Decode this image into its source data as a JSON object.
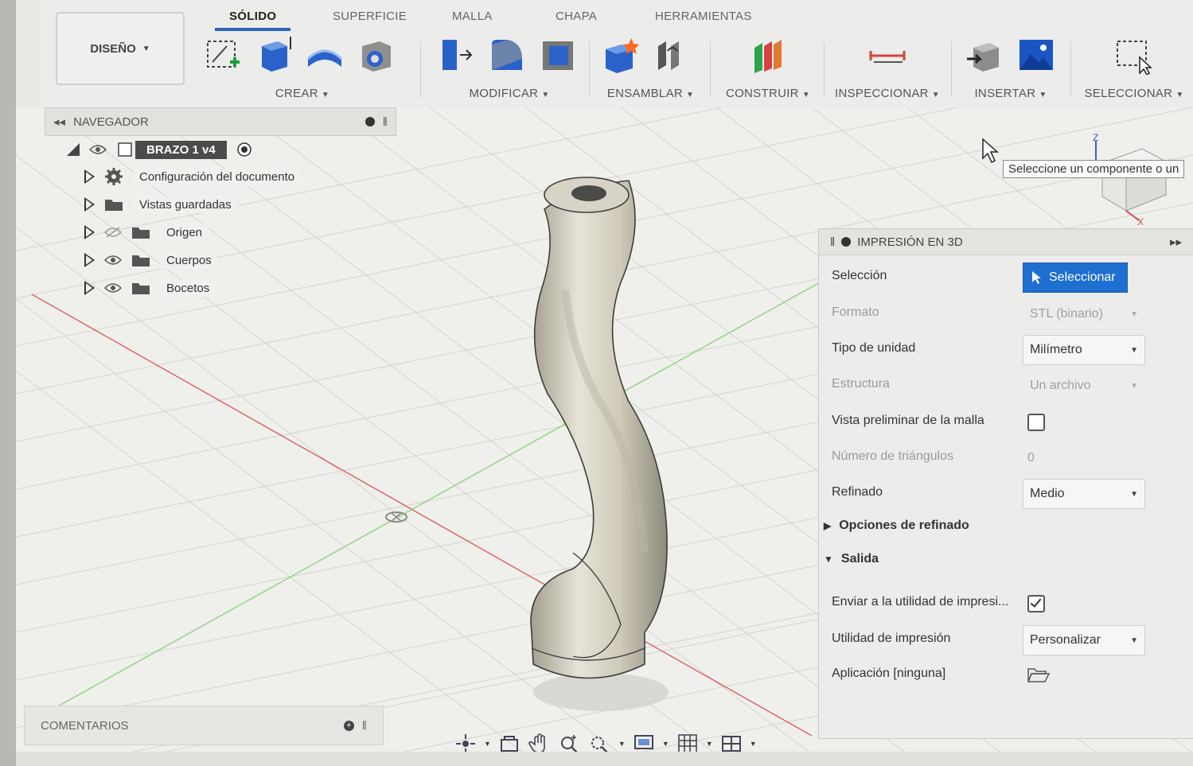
{
  "toolbar": {
    "workspace": "DISEÑO",
    "tabs": [
      "SÓLIDO",
      "SUPERFICIE",
      "MALLA",
      "CHAPA",
      "HERRAMIENTAS"
    ],
    "active_tab": "SÓLIDO",
    "groups": {
      "crear": "CREAR",
      "modificar": "MODIFICAR",
      "ensamblar": "ENSAMBLAR",
      "construir": "CONSTRUIR",
      "inspeccionar": "INSPECCIONAR",
      "insertar": "INSERTAR",
      "seleccionar": "SELECCIONAR"
    }
  },
  "browser": {
    "title": "NAVEGADOR",
    "root": "BRAZO 1 v4",
    "items": [
      {
        "label": "Configuración del documento",
        "icon": "gear-icon"
      },
      {
        "label": "Vistas guardadas",
        "icon": "folder-icon"
      },
      {
        "label": "Origen",
        "icon": "folder-icon",
        "hidden": true
      },
      {
        "label": "Cuerpos",
        "icon": "folder-icon"
      },
      {
        "label": "Bocetos",
        "icon": "folder-icon"
      }
    ]
  },
  "tooltip": "Seleccione un componente o un",
  "print_panel": {
    "title": "IMPRESIÓN EN 3D",
    "rows": {
      "seleccion": {
        "label": "Selección",
        "button": "Seleccionar"
      },
      "formato": {
        "label": "Formato",
        "value": "STL (binario)"
      },
      "unidad": {
        "label": "Tipo de unidad",
        "value": "Milímetro"
      },
      "estructura": {
        "label": "Estructura",
        "value": "Un archivo"
      },
      "vista_malla": {
        "label": "Vista preliminar de la malla",
        "checked": false
      },
      "triangulos": {
        "label": "Número de triángulos",
        "value": "0"
      },
      "refinado": {
        "label": "Refinado",
        "value": "Medio"
      },
      "opciones": {
        "label": "Opciones de refinado"
      },
      "salida": {
        "label": "Salida"
      },
      "enviar": {
        "label": "Enviar a la utilidad de impresi...",
        "checked": true
      },
      "utilidad": {
        "label": "Utilidad de impresión",
        "value": "Personalizar"
      },
      "aplicacion": {
        "label": "Aplicación [ninguna]"
      }
    }
  },
  "comments": {
    "label": "COMENTARIOS"
  },
  "colors": {
    "accent": "#1f6fd1",
    "tab_underline": "#2f63b8",
    "x_axis": "#d94a4a",
    "y_axis": "#7bd36a"
  }
}
